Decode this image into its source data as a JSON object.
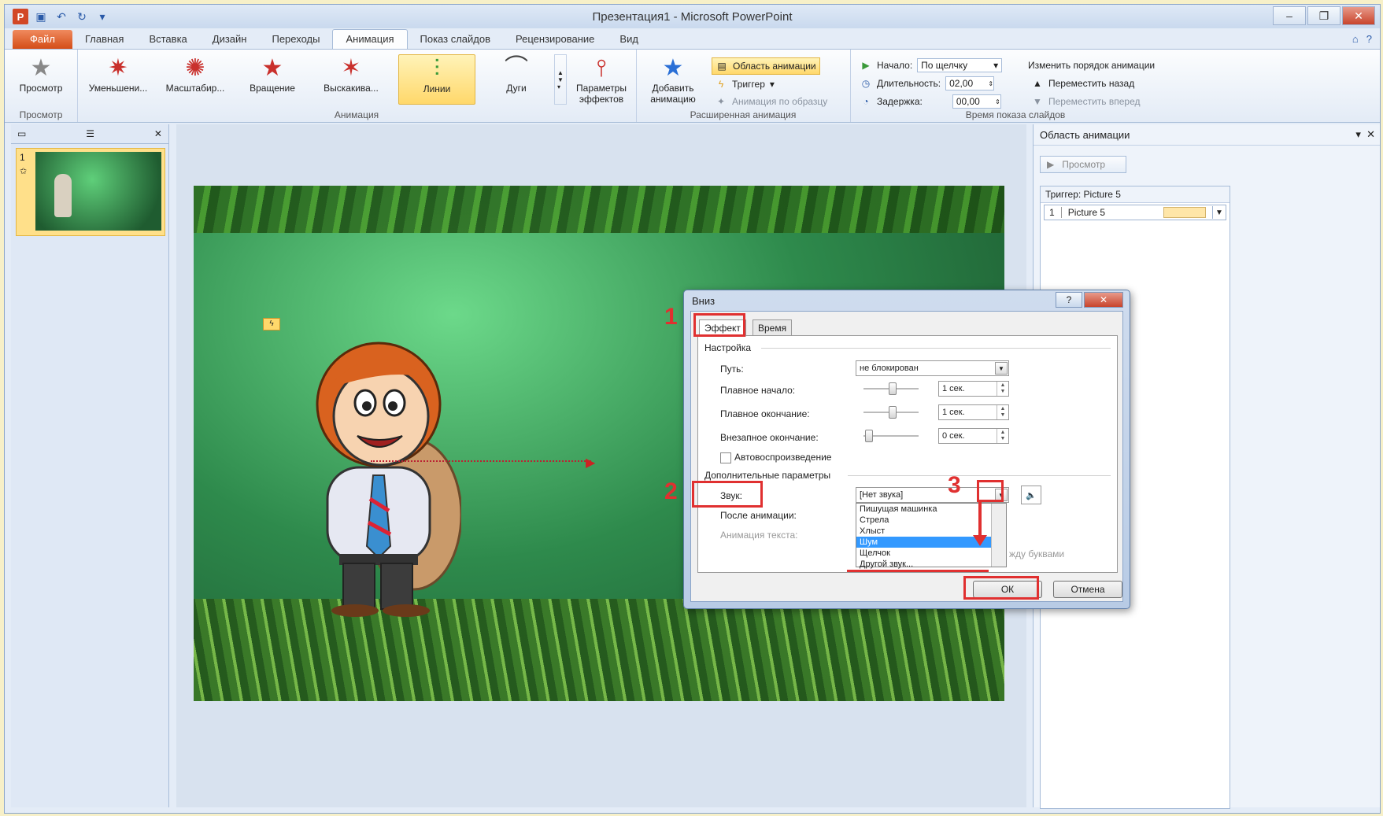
{
  "window": {
    "title": "Презентация1 - Microsoft PowerPoint"
  },
  "tabs": [
    "Файл",
    "Главная",
    "Вставка",
    "Дизайн",
    "Переходы",
    "Анимация",
    "Показ слайдов",
    "Рецензирование",
    "Вид"
  ],
  "active_tab": "Анимация",
  "ribbon": {
    "preview": {
      "label": "Просмотр",
      "group": "Просмотр"
    },
    "animation_group": {
      "label": "Анимация",
      "effects": [
        {
          "name": "Уменьшени...",
          "icon": "shrink-star-icon"
        },
        {
          "name": "Масштабир...",
          "icon": "zoom-star-icon"
        },
        {
          "name": "Вращение",
          "icon": "spin-star-icon"
        },
        {
          "name": "Выскакива...",
          "icon": "bounce-star-icon"
        },
        {
          "name": "Линии",
          "icon": "lines-path-icon",
          "selected": true
        },
        {
          "name": "Дуги",
          "icon": "arcs-path-icon"
        }
      ],
      "effect_options": "Параметры эффектов"
    },
    "advanced_group": {
      "label": "Расширенная анимация",
      "add_animation": "Добавить анимацию",
      "animation_pane": "Область анимации",
      "trigger": "Триггер",
      "painter": "Анимация по образцу"
    },
    "timing_group": {
      "label": "Время показа слайдов",
      "start_label": "Начало:",
      "start_value": "По щелчку",
      "duration_label": "Длительность:",
      "duration_value": "02,00",
      "delay_label": "Задержка:",
      "delay_value": "00,00",
      "reorder_title": "Изменить порядок анимации",
      "move_back": "Переместить назад",
      "move_forward": "Переместить вперед"
    }
  },
  "slides": {
    "number": "1"
  },
  "animation_pane": {
    "title": "Область анимации",
    "play": "Просмотр",
    "trigger": "Триггер: Picture 5",
    "item_num": "1",
    "item_name": "Picture 5"
  },
  "dialog": {
    "title": "Вниз",
    "tabs": [
      "Эффект",
      "Время"
    ],
    "settings_section": "Настройка",
    "path_label": "Путь:",
    "path_value": "не блокирован",
    "smooth_start_label": "Плавное начало:",
    "smooth_start_value": "1 сек.",
    "smooth_end_label": "Плавное окончание:",
    "smooth_end_value": "1 сек.",
    "bounce_end_label": "Внезапное окончание:",
    "bounce_end_value": "0 сек.",
    "autoreverse_label": "Автовоспроизведение",
    "enhancements_section": "Дополнительные параметры",
    "sound_label": "Звук:",
    "sound_value": "[Нет звука]",
    "after_anim_label": "После анимации:",
    "text_anim_label": "Анимация текста:",
    "between_letters": "жду буквами",
    "sound_options": [
      "Пишущая машинка",
      "Стрела",
      "Хлыст",
      "Шум",
      "Щелчок",
      "Другой звук..."
    ],
    "sound_selected_index": 3,
    "ok": "ОК",
    "cancel": "Отмена"
  },
  "annotations": [
    "1",
    "2",
    "3"
  ],
  "colors": {
    "annotation": "#e03030",
    "selected_highlight": "#ffd86b",
    "list_selection": "#3399ff"
  }
}
